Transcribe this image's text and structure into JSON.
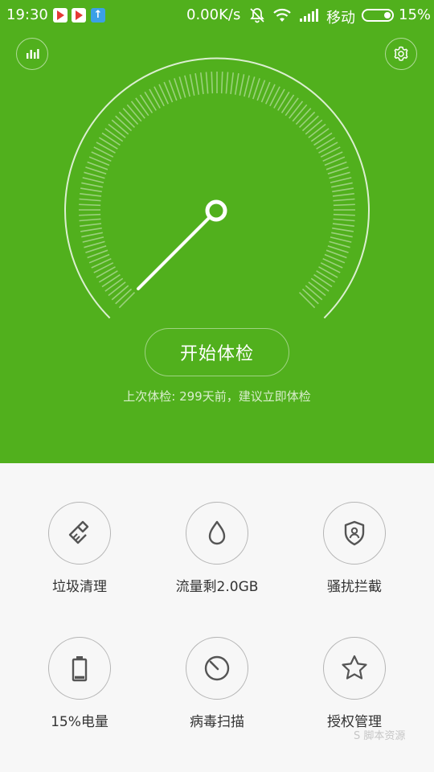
{
  "status_bar": {
    "time": "19:30",
    "network_speed": "0.00K/s",
    "carrier": "移动",
    "battery_percent": "15%",
    "battery_level": 0.15,
    "app_icons": [
      "play-store-icon",
      "play-store-icon",
      "upload-icon"
    ]
  },
  "header": {
    "stats_icon": "bar-chart-icon",
    "settings_icon": "gear-icon"
  },
  "gauge": {
    "needle_icon": "speedometer-needle"
  },
  "start_button_label": "开始体检",
  "last_check_text": "上次体检: 299天前，建议立即体检",
  "tools": [
    {
      "label": "垃圾清理",
      "icon": "broom-icon"
    },
    {
      "label": "流量剩2.0GB",
      "icon": "droplet-icon"
    },
    {
      "label": "骚扰拦截",
      "icon": "shield-user-icon"
    },
    {
      "label": "15%电量",
      "icon": "battery-icon"
    },
    {
      "label": "病毒扫描",
      "icon": "scan-dial-icon"
    },
    {
      "label": "授权管理",
      "icon": "star-icon"
    }
  ],
  "watermark": "S 脚本资源",
  "colors": {
    "hero_green": "#51b01d",
    "panel_bg": "#f7f7f7",
    "icon_gray": "#555555"
  }
}
